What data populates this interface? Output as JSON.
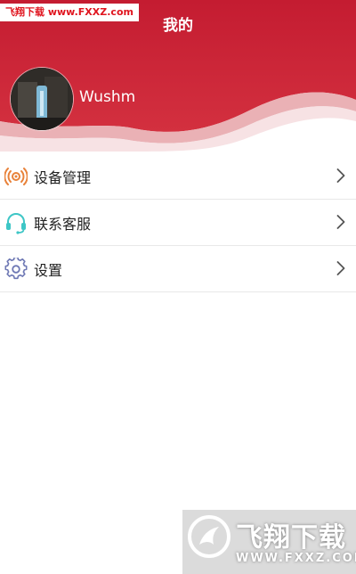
{
  "watermark_top": {
    "text": "飞翔下载 www.FXXZ.com"
  },
  "header": {
    "title": "我的"
  },
  "profile": {
    "username": "Wushm"
  },
  "menu": {
    "items": [
      {
        "label": "设备管理",
        "icon": "device-signal-icon",
        "icon_color": "#e8823a"
      },
      {
        "label": "联系客服",
        "icon": "headset-icon",
        "icon_color": "#3ec6c6"
      },
      {
        "label": "设置",
        "icon": "gear-icon",
        "icon_color": "#6e78b4"
      }
    ]
  },
  "watermark_bottom": {
    "brand": "飞翔下载",
    "url": "WWW.FXXZ.COM"
  },
  "colors": {
    "header_red": "#c91f35",
    "accent_orange": "#e8823a",
    "accent_teal": "#3ec6c6",
    "accent_purple": "#6e78b4"
  }
}
